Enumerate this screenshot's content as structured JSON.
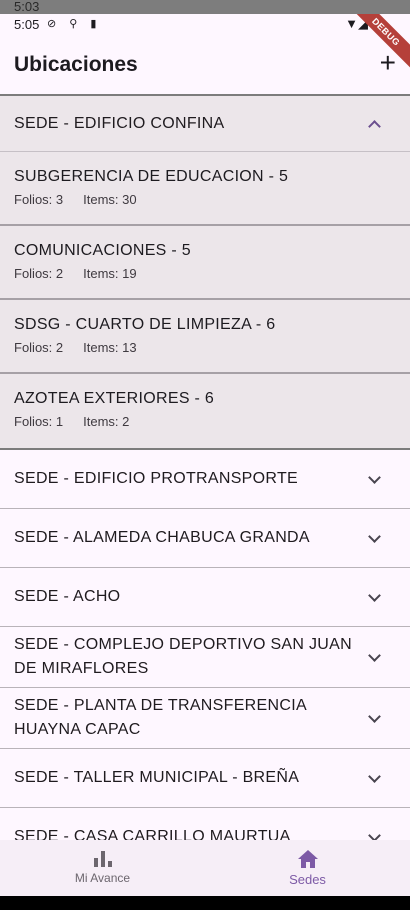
{
  "ghost_status": {
    "time": "5:03"
  },
  "status": {
    "time": "5:05",
    "icons": "⊘ ⚲ ▮",
    "right": "▼◢",
    "debug_banner": "DEBUG"
  },
  "appbar": {
    "title": "Ubicaciones",
    "add_icon": "+"
  },
  "expanded_sede": {
    "name": "SEDE - EDIFICIO CONFINA",
    "subs": [
      {
        "name": "SUBGERENCIA DE EDUCACION - 5",
        "folios": "Folios: 3",
        "items": "Items: 30"
      },
      {
        "name": "COMUNICACIONES - 5",
        "folios": "Folios: 2",
        "items": "Items: 19"
      },
      {
        "name": "SDSG - CUARTO DE LIMPIEZA - 6",
        "folios": "Folios: 2",
        "items": "Items: 13"
      },
      {
        "name": "AZOTEA EXTERIORES - 6",
        "folios": "Folios: 1",
        "items": "Items: 2"
      }
    ]
  },
  "sedes": [
    "SEDE - EDIFICIO PROTRANSPORTE",
    "SEDE - ALAMEDA CHABUCA GRANDA",
    "SEDE - ACHO",
    "SEDE - COMPLEJO DEPORTIVO SAN JUAN DE MIRAFLORES",
    "SEDE - PLANTA DE TRANSFERENCIA HUAYNA CAPAC",
    "SEDE - TALLER MUNICIPAL - BREÑA",
    "SEDE - CASA CARRILLO MAURTUA"
  ],
  "navbar": {
    "items": [
      {
        "label": "Mi Avance",
        "icon": "bar-chart-icon",
        "active": false
      },
      {
        "label": "Sedes",
        "icon": "home-icon",
        "active": true
      }
    ]
  },
  "colors": {
    "accent": "#7d5aa6",
    "background": "#fef7ff",
    "expanded_bg": "#ece6ea"
  }
}
